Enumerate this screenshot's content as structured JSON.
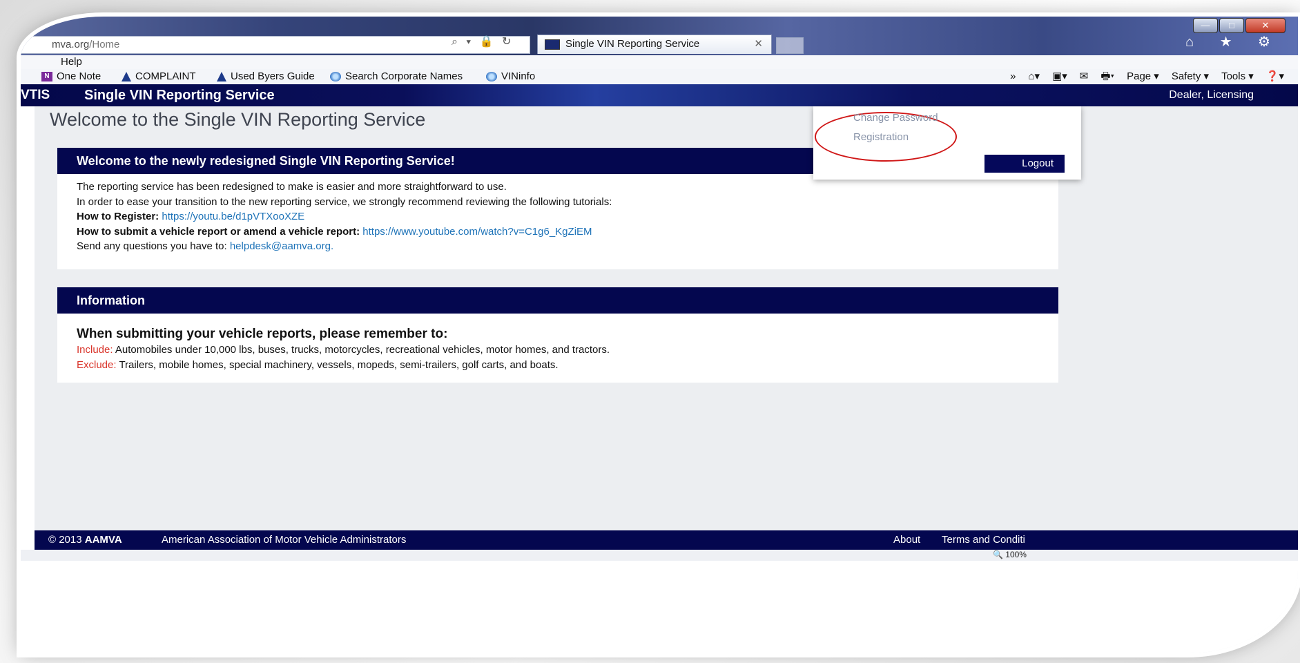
{
  "browser": {
    "address_domain": "mva.org",
    "address_path": "/Home",
    "address_icons": "⌕ ▾ 🔒 ↻",
    "tab_title": "Single VIN Reporting Service",
    "tab_close": "✕",
    "nav_icons": "⌂ ★ ⚙",
    "menu_help": "Help",
    "favorites": [
      {
        "label": "One Note",
        "icon": "onenote-icon"
      },
      {
        "label": "COMPLAINT",
        "icon": "bell-icon"
      },
      {
        "label": "Used Byers Guide",
        "icon": "bell-icon"
      },
      {
        "label": "Search Corporate Names",
        "icon": "ie-icon"
      },
      {
        "label": "VINinfo",
        "icon": "ie-icon"
      }
    ],
    "toolbar": {
      "more": "»",
      "page": "Page ▾",
      "safety": "Safety ▾",
      "tools": "Tools ▾",
      "help": "❓▾"
    },
    "window_controls": {
      "minimize": "—",
      "maximize": "□",
      "close": "✕"
    },
    "zoom": "🔍 100%"
  },
  "header": {
    "brand": "VTIS",
    "title": "Single VIN Reporting Service",
    "user": "Dealer, Licensing"
  },
  "dropdown": {
    "change_password": "Change Password",
    "registration": "Registration",
    "logout": "Logout"
  },
  "page_title": "Welcome to the Single VIN Reporting Service",
  "welcome_panel": {
    "heading": "Welcome to the newly redesigned Single VIN Reporting Service!",
    "line1": "The reporting service has been redesigned to make is easier and more straightforward to use.",
    "line2": "In order to ease your transition to the new reporting service, we strongly recommend reviewing the following tutorials:",
    "register_label": "How to Register:",
    "register_link": "https://youtu.be/d1pVTXooXZE",
    "submit_label": "How to submit a vehicle report or amend a vehicle report:",
    "submit_link": "https://www.youtube.com/watch?v=C1g6_KgZiEM",
    "questions_text": "Send any questions you have to:",
    "questions_email": "helpdesk@aamva.org."
  },
  "info_panel": {
    "heading": "Information",
    "subheading": "When submitting your vehicle reports, please remember to:",
    "include_label": "Include:",
    "include_text": "Automobiles under 10,000 lbs, buses, trucks, motorcycles, recreational vehicles, motor homes, and tractors.",
    "exclude_label": "Exclude:",
    "exclude_text": "Trailers, mobile homes, special machinery, vessels, mopeds, semi-trailers, golf carts, and boats."
  },
  "footer": {
    "copyright_prefix": "© 2013",
    "copyright_org": "AAMVA",
    "org_name": "American Association of Motor Vehicle Administrators",
    "about": "About",
    "terms": "Terms and Conditi"
  }
}
